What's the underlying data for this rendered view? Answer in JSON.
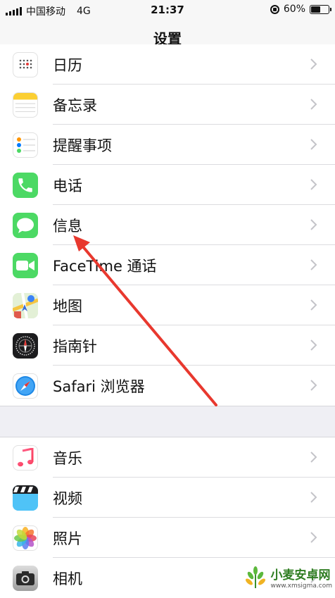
{
  "status_bar": {
    "carrier": "中国移动",
    "network": "4G",
    "time": "21:37",
    "battery": "60%",
    "battery_level": 0.6
  },
  "nav": {
    "title": "设置"
  },
  "group1": [
    {
      "label": "日历",
      "icon": "calendar-icon"
    },
    {
      "label": "备忘录",
      "icon": "notes-icon"
    },
    {
      "label": "提醒事项",
      "icon": "reminders-icon"
    },
    {
      "label": "电话",
      "icon": "phone-icon"
    },
    {
      "label": "信息",
      "icon": "messages-icon"
    },
    {
      "label": "FaceTime 通话",
      "icon": "facetime-icon"
    },
    {
      "label": "地图",
      "icon": "maps-icon"
    },
    {
      "label": "指南针",
      "icon": "compass-icon"
    },
    {
      "label": "Safari 浏览器",
      "icon": "safari-icon"
    }
  ],
  "group2": [
    {
      "label": "音乐",
      "icon": "music-icon"
    },
    {
      "label": "视频",
      "icon": "videos-icon"
    },
    {
      "label": "照片",
      "icon": "photos-icon"
    },
    {
      "label": "相机",
      "icon": "camera-icon"
    }
  ],
  "watermark": {
    "title": "小麦安卓网",
    "url": "www.xmsigma.com"
  },
  "colors": {
    "annotation_arrow": "#e8382e",
    "phone_green": "#4cd964",
    "safari_blue": "#1e88e5"
  }
}
